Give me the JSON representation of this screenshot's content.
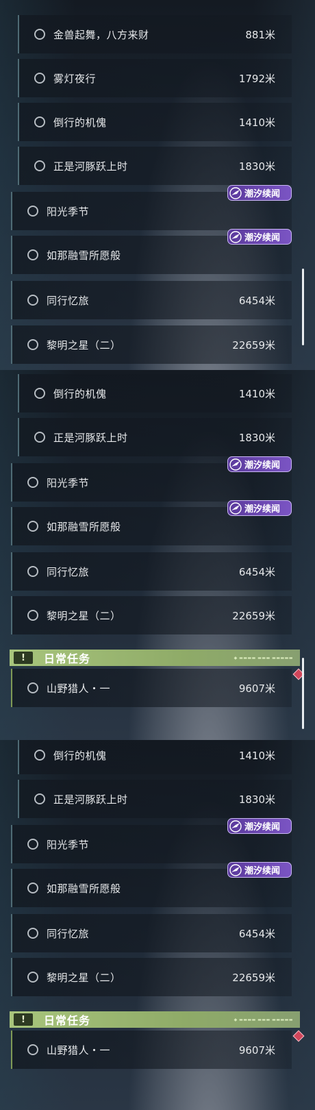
{
  "colors": {
    "badge": "#6b48b3",
    "daily_header": "#a8c57c",
    "daily_marker": "#d0455a"
  },
  "icons": {
    "incomplete": "circle-outline-icon",
    "badge": "bird-emblem-icon",
    "daily": "exclamation-icon",
    "marker": "diamond-marker-icon"
  },
  "panel1": {
    "scroll_position_fraction": 0.7,
    "quests": [
      {
        "title": "金兽起舞，八方来财",
        "distance": "881米"
      },
      {
        "title": "雾灯夜行",
        "distance": "1792米"
      },
      {
        "title": "倒行的机傀",
        "distance": "1410米"
      },
      {
        "title": "正是河豚跃上时",
        "distance": "1830米"
      },
      {
        "title": "阳光季节",
        "badge": "潮汐续闻"
      },
      {
        "title": "如那融雪所愿般",
        "badge": "潮汐续闻"
      },
      {
        "title": "同行忆旅",
        "distance": "6454米"
      },
      {
        "title": "黎明之星（二）",
        "distance": "22659米"
      }
    ]
  },
  "panel2": {
    "scroll_position_fraction": 0.9,
    "quests": [
      {
        "title": "倒行的机傀",
        "distance": "1410米"
      },
      {
        "title": "正是河豚跃上时",
        "distance": "1830米"
      },
      {
        "title": "阳光季节",
        "badge": "潮汐续闻"
      },
      {
        "title": "如那融雪所愿般",
        "badge": "潮汐续闻"
      },
      {
        "title": "同行忆旅",
        "distance": "6454米"
      },
      {
        "title": "黎明之星（二）",
        "distance": "22659米"
      }
    ],
    "daily_header": "日常任务",
    "daily_quest": {
      "title": "山野猎人・一",
      "distance": "9607米"
    }
  },
  "panel3": {
    "quests": [
      {
        "title": "倒行的机傀",
        "distance": "1410米"
      },
      {
        "title": "正是河豚跃上时",
        "distance": "1830米"
      },
      {
        "title": "阳光季节",
        "badge": "潮汐续闻"
      },
      {
        "title": "如那融雪所愿般",
        "badge": "潮汐续闻"
      },
      {
        "title": "同行忆旅",
        "distance": "6454米"
      },
      {
        "title": "黎明之星（二）",
        "distance": "22659米"
      }
    ],
    "daily_header": "日常任务",
    "daily_quest": {
      "title": "山野猎人・一",
      "distance": "9607米"
    }
  }
}
